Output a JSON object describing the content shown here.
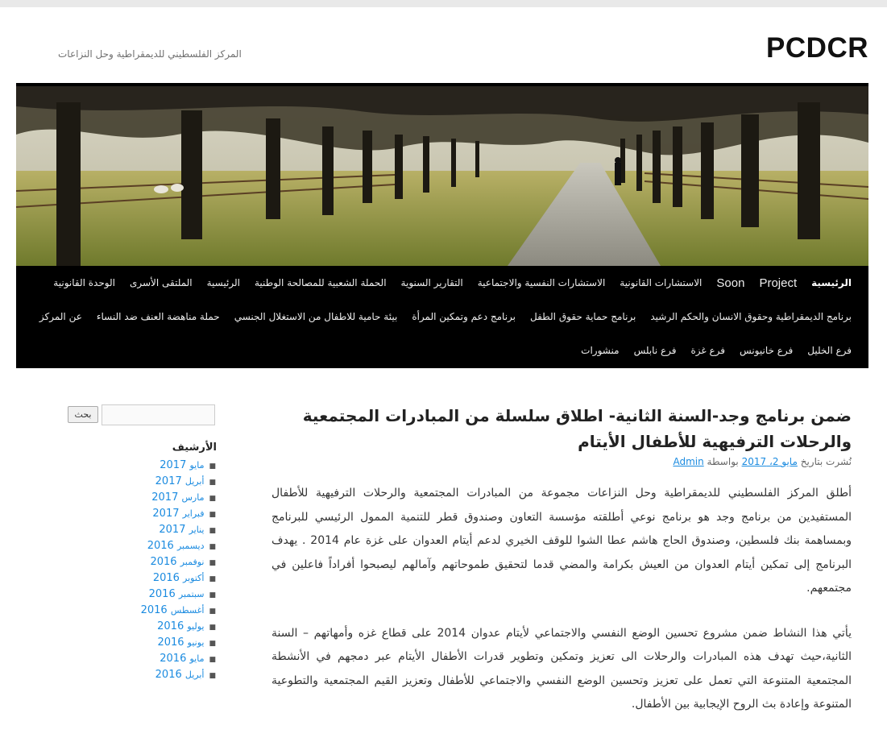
{
  "site": {
    "title": "PCDCR",
    "description": "المركز الفلسطيني للديمقراطية وحل النزاعات"
  },
  "nav": {
    "row1": [
      "الرئيسية",
      "Project",
      "Soon",
      "الاستشارات القانونية",
      "الاستشارات النفسية والاجتماعية",
      "التقارير السنوية",
      "الحملة الشعبية للمصالحة الوطنية",
      "الرئيسية",
      "الملتقى الأسرى",
      "الوحدة القانونية"
    ],
    "row2": [
      "برنامج الديمقراطية وحقوق الانسان والحكم الرشيد",
      "برنامج حماية حقوق الطفل",
      "برنامج دعم وتمكين المرأة",
      "بيئة حامية للاطفال من الاستغلال الجنسي",
      "حملة مناهضة العنف ضد النساء",
      "عن المركز"
    ],
    "row3": [
      "فرع الخليل",
      "فرع خانيونس",
      "فرع غزة",
      "فرع نابلس",
      "منشورات"
    ]
  },
  "search": {
    "button_label": "بحث",
    "value": ""
  },
  "archive": {
    "title": "الأرشيف",
    "items": [
      {
        "month": "مايو",
        "year": "2017"
      },
      {
        "month": "أبريل",
        "year": "2017"
      },
      {
        "month": "مارس",
        "year": "2017"
      },
      {
        "month": "فبراير",
        "year": "2017"
      },
      {
        "month": "يناير",
        "year": "2017"
      },
      {
        "month": "ديسمبر",
        "year": "2016"
      },
      {
        "month": "نوفمبر",
        "year": "2016"
      },
      {
        "month": "أكتوبر",
        "year": "2016"
      },
      {
        "month": "سبتمبر",
        "year": "2016"
      },
      {
        "month": "أغسطس",
        "year": "2016"
      },
      {
        "month": "يوليو",
        "year": "2016"
      },
      {
        "month": "يونيو",
        "year": "2016"
      },
      {
        "month": "مايو",
        "year": "2016"
      },
      {
        "month": "أبريل",
        "year": "2016"
      }
    ]
  },
  "post": {
    "title": "ضمن برنامج وجد-السنة الثانية- اطلاق سلسلة من المبادرات المجتمعية والرحلات الترفيهية للأطفال الأيتام",
    "meta_prefix": "نُشرت بتاريخ",
    "date": "مايو 2، 2017",
    "meta_by": "بواسطة",
    "author": "Admin",
    "paragraphs": [
      "أطلق المركز  الفلسطيني للديمقراطية وحل النزاعات مجموعة من المبادرات المجتمعية والرحلات الترفيهية للأطفال المستفيدين من برنامج وجد هو برنامج نوعي أطلقته مؤسسة التعاون وصندوق قطر للتنمية الممول الرئيسي للبرنامج وبمساهمة بنك فلسطين، وصندوق الحاج هاشم عطا الشوا للوقف الخيري لدعم أيتام العدوان على غزة عام 2014 . يهدف البرنامج إلى تمكين أيتام العدوان من العيش  بكرامة  والمضي قدما لتحقيق طموحاتهم  وآمالهم ليصبحوا أفراداً فاعلين في مجتمعهم.",
      "يأتي هذا النشاط ضمن مشروع تحسين الوضع النفسي والاجتماعي لأيتام عدوان 2014 على قطاع غزه وأمهاتهم – السنة الثانية،حيث تهدف هذه المبادرات والرحلات الى تعزيز وتمكين وتطوير قدرات الأطفال الأيتام عبر دمجهم في الأنشطة المجتمعية المتنوعة التي تعمل على تعزيز وتحسين الوضع النفسي والاجتماعي للأطفال وتعزيز القيم المجتمعية والتطوعية المتنوعة وإعادة بث الروح الإيجابية بين الأطفال."
    ]
  }
}
